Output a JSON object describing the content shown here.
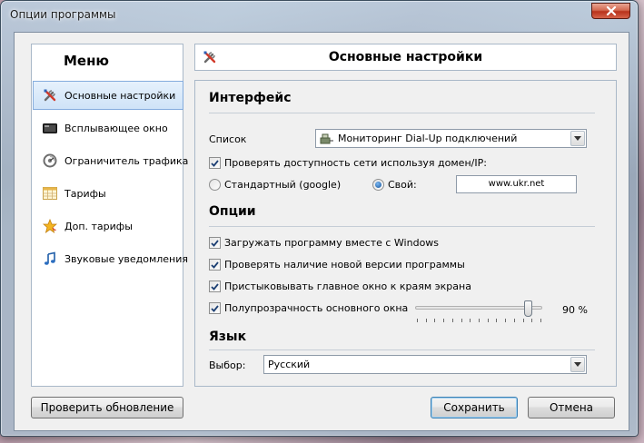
{
  "window": {
    "title": "Опции программы"
  },
  "sidebar": {
    "title": "Меню",
    "items": [
      {
        "label": "Основные настройки",
        "icon": "tools-icon",
        "active": true
      },
      {
        "label": "Всплывающее окно",
        "icon": "popup-window-icon",
        "active": false
      },
      {
        "label": "Ограничитель трафика",
        "icon": "traffic-limiter-icon",
        "active": false
      },
      {
        "label": "Тарифы",
        "icon": "tariffs-table-icon",
        "active": false
      },
      {
        "label": "Доп. тарифы",
        "icon": "star-icon",
        "active": false
      },
      {
        "label": "Звуковые уведомления",
        "icon": "music-note-icon",
        "active": false
      }
    ]
  },
  "header": {
    "title": "Основные настройки",
    "icon": "tools-icon"
  },
  "interface": {
    "title": "Интерфейс",
    "list_label": "Список",
    "list_value": "Мониторинг Dial-Up подключений",
    "check_network_label": "Проверять доступность сети используя домен/IP:",
    "check_network_checked": true,
    "radio_standard_label": "Стандартный (google)",
    "radio_standard_selected": false,
    "radio_custom_label": "Свой:",
    "radio_custom_selected": true,
    "custom_host_value": "www.ukr.net"
  },
  "options": {
    "title": "Опции",
    "items": [
      {
        "label": "Загружать программу вместе с Windows",
        "checked": true
      },
      {
        "label": "Проверять наличие новой версии программы",
        "checked": true
      },
      {
        "label": "Пристыковывать главное окно к краям экрана",
        "checked": true
      },
      {
        "label": "Полупрозрачность основного окна",
        "checked": true
      }
    ],
    "transparency_value": 90,
    "transparency_text": "90 %"
  },
  "language": {
    "title": "Язык",
    "select_label": "Выбор:",
    "select_value": "Русский"
  },
  "buttons": {
    "check_update": "Проверить обновление",
    "save": "Сохранить",
    "cancel": "Отмена"
  },
  "colors": {
    "accent": "#84acdd",
    "close_button": "#c4402a",
    "radio_dot": "#17539a"
  }
}
